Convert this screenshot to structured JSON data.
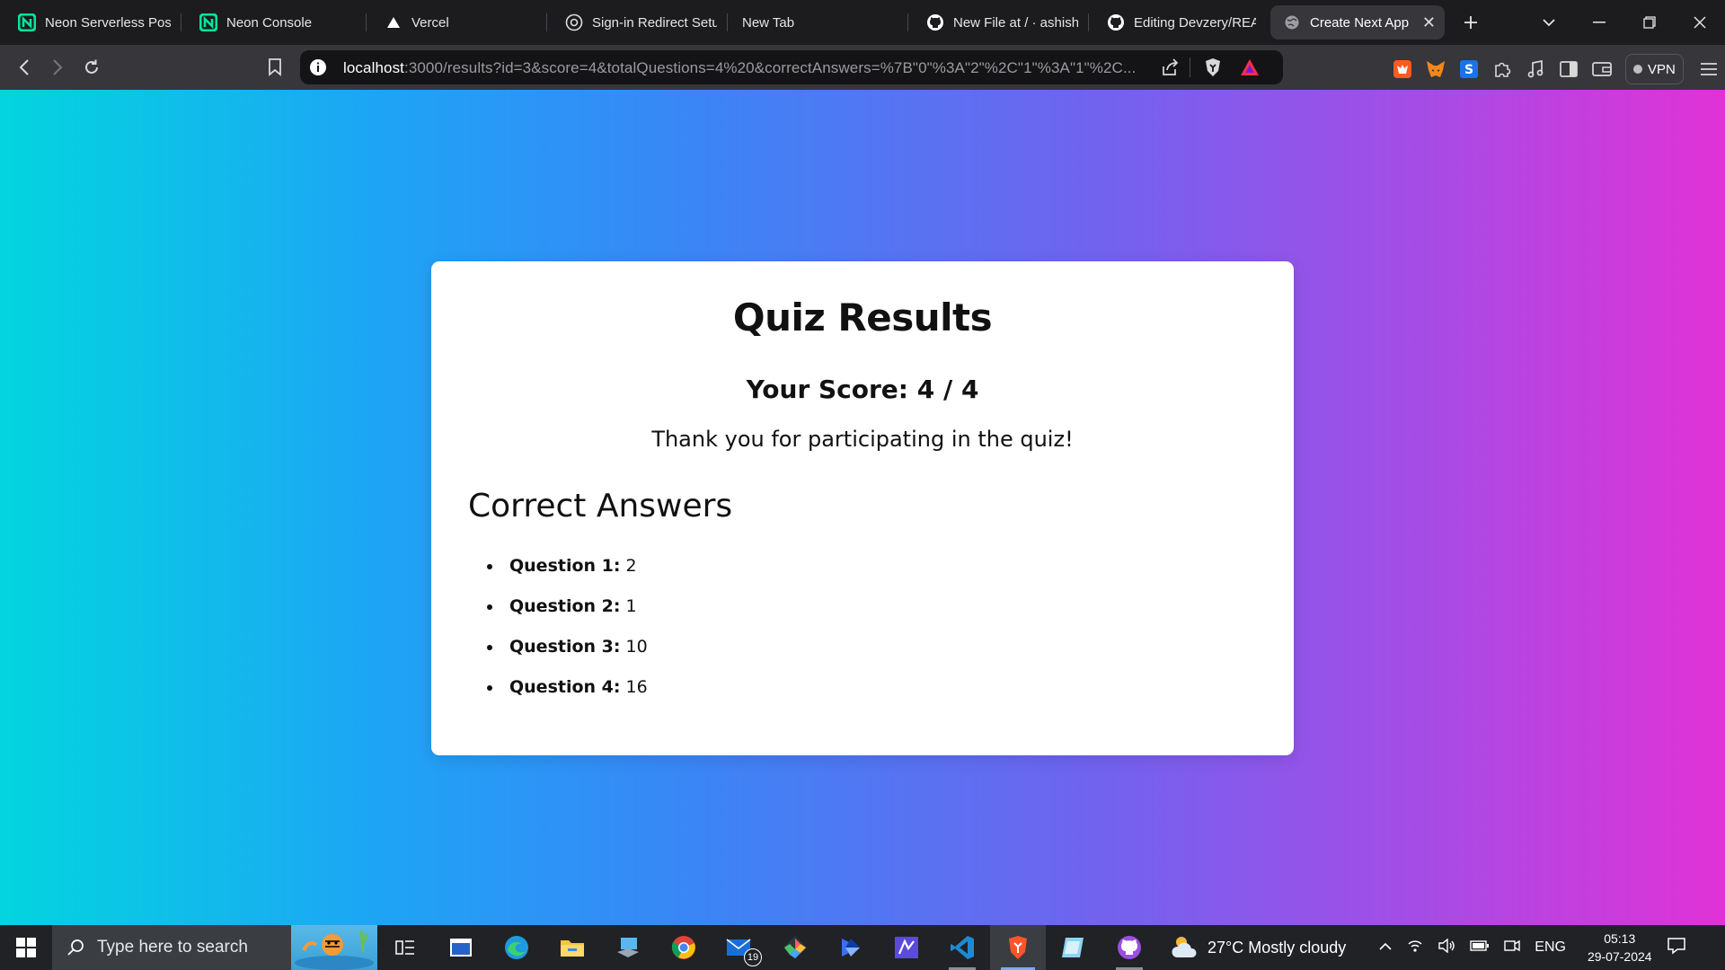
{
  "browser": {
    "tabs": [
      {
        "title": "Neon Serverless Post",
        "icon": "neon-logo-icon"
      },
      {
        "title": "Neon Console",
        "icon": "neon-logo-icon"
      },
      {
        "title": "Vercel",
        "icon": "vercel-logo-icon"
      },
      {
        "title": "Sign-in Redirect Setu",
        "icon": "openai-logo-icon"
      },
      {
        "title": "New Tab",
        "icon": ""
      },
      {
        "title": "New File at / · ashish",
        "icon": "github-logo-icon"
      },
      {
        "title": "Editing Devzery/REAI",
        "icon": "github-logo-icon"
      },
      {
        "title": "Create Next App",
        "icon": "globe-icon",
        "active": true
      }
    ],
    "url_host": "localhost",
    "url_rest": ":3000/results?id=3&score=4&totalQuestions=4%20&correctAnswers=%7B\"0\"%3A\"2\"%2C\"1\"%3A\"1\"%2C...",
    "vpn_label": "VPN"
  },
  "page": {
    "title": "Quiz Results",
    "score_label": "Your Score: 4 / 4",
    "thanks": "Thank you for participating in the quiz!",
    "answers_heading": "Correct Answers",
    "answers": [
      {
        "label": "Question 1:",
        "value": "2"
      },
      {
        "label": "Question 2:",
        "value": "1"
      },
      {
        "label": "Question 3:",
        "value": "10"
      },
      {
        "label": "Question 4:",
        "value": "16"
      }
    ]
  },
  "taskbar": {
    "search_placeholder": "Type here to search",
    "mail_badge": "19",
    "weather": "27°C  Mostly cloudy",
    "language": "ENG",
    "time": "05:13",
    "date": "29-07-2024"
  },
  "colors": {
    "gradient_left": "#03d5de",
    "gradient_mid": "#3a86f6",
    "gradient_right": "#e032d6",
    "card": "#ffffff"
  }
}
